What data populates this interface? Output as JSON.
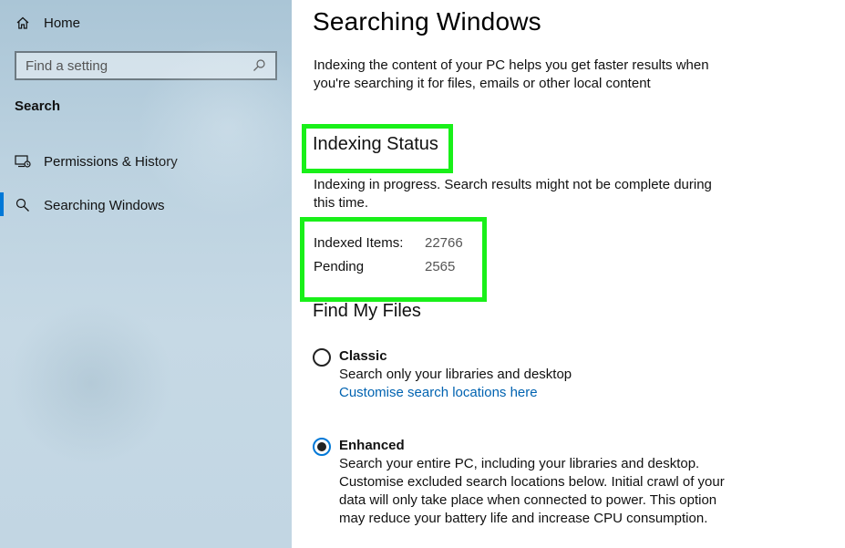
{
  "sidebar": {
    "home_label": "Home",
    "search_placeholder": "Find a setting",
    "section_title": "Search",
    "items": [
      {
        "label": "Permissions & History",
        "icon": "permissions-icon",
        "active": false
      },
      {
        "label": "Searching Windows",
        "icon": "search-icon",
        "active": true
      }
    ]
  },
  "main": {
    "title": "Searching Windows",
    "description": "Indexing the content of your PC helps you get faster results when you're searching it for files, emails or other local content",
    "indexing_status": {
      "heading": "Indexing Status",
      "text": "Indexing in progress. Search results might not be complete during this time.",
      "indexed_label": "Indexed Items:",
      "indexed_value": "22766",
      "pending_label": "Pending",
      "pending_value": "2565"
    },
    "find_my_files": {
      "heading": "Find My Files",
      "classic": {
        "label": "Classic",
        "description": "Search only your libraries and desktop",
        "link": "Customise search locations here",
        "selected": false
      },
      "enhanced": {
        "label": "Enhanced",
        "description": "Search your entire PC, including your libraries and desktop. Customise excluded search locations below. Initial crawl of your data will only take place when connected to power. This option may reduce your battery life and increase CPU consumption.",
        "selected": true
      }
    }
  },
  "colors": {
    "accent": "#0078d7",
    "highlight": "#19f019",
    "link": "#0063b1"
  }
}
